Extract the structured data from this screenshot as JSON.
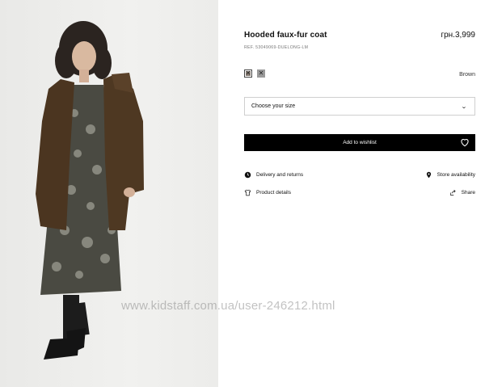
{
  "product": {
    "title": "Hooded faux-fur coat",
    "price": "грн.3,999",
    "ref": "REF. 53049069-DUELONG-LM",
    "color_name": "Brown",
    "swatches": [
      {
        "color": "#8a7f76",
        "selected": true
      },
      {
        "color": "#9a9a9a",
        "selected": false
      }
    ]
  },
  "size_select": {
    "label": "Choose your size"
  },
  "wishlist_button": {
    "label": "Add to wishlist"
  },
  "info": {
    "delivery": "Delivery and returns",
    "store": "Store availability",
    "details": "Product details",
    "share": "Share"
  },
  "watermark": "www.kidstaff.com.ua/user-246212.html",
  "icons": {
    "heart": "heart-icon",
    "truck": "clock-icon",
    "pin": "location-pin-icon",
    "shirt": "tshirt-icon",
    "share": "share-icon",
    "chevron": "chevron-down-icon"
  }
}
